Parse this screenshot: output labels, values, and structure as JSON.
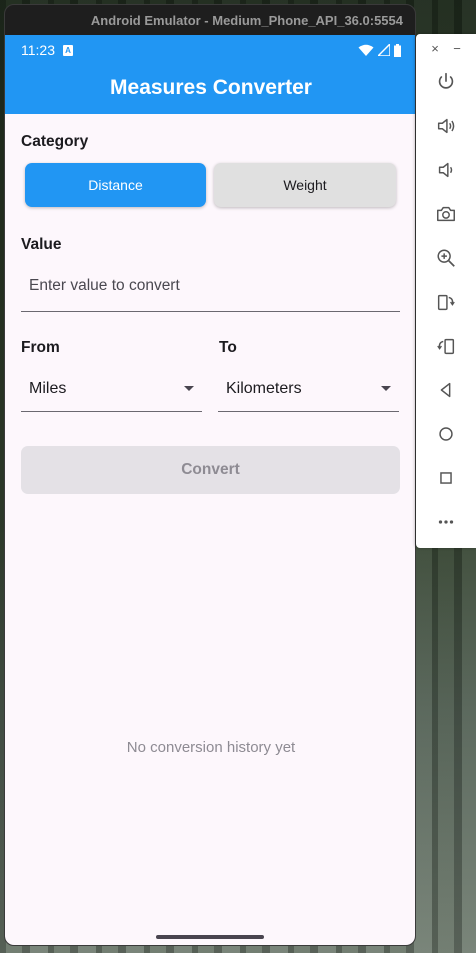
{
  "window": {
    "title": "Android Emulator - Medium_Phone_API_36.0:5554"
  },
  "statusbar": {
    "time": "11:23",
    "notification_badge": "A"
  },
  "appbar": {
    "title": "Measures Converter"
  },
  "category": {
    "label": "Category",
    "options": [
      "Distance",
      "Weight"
    ],
    "selected": "Distance"
  },
  "value": {
    "label": "Value",
    "placeholder": "Enter value to convert"
  },
  "from": {
    "label": "From",
    "selected": "Miles"
  },
  "to": {
    "label": "To",
    "selected": "Kilometers"
  },
  "convert": {
    "label": "Convert"
  },
  "history": {
    "empty_text": "No conversion history yet"
  },
  "side_toolbar": {
    "close_glyph": "×",
    "minimize_glyph": "−",
    "tools": [
      "power-icon",
      "volume-up-icon",
      "volume-down-icon",
      "camera-icon",
      "zoom-in-icon",
      "rotate-left-icon",
      "rotate-right-icon",
      "back-icon",
      "home-icon",
      "overview-icon",
      "more-icon"
    ]
  },
  "colors": {
    "primary": "#2196f3",
    "surface": "#fdf7fc",
    "disabled_button": "#e4e1e6"
  }
}
